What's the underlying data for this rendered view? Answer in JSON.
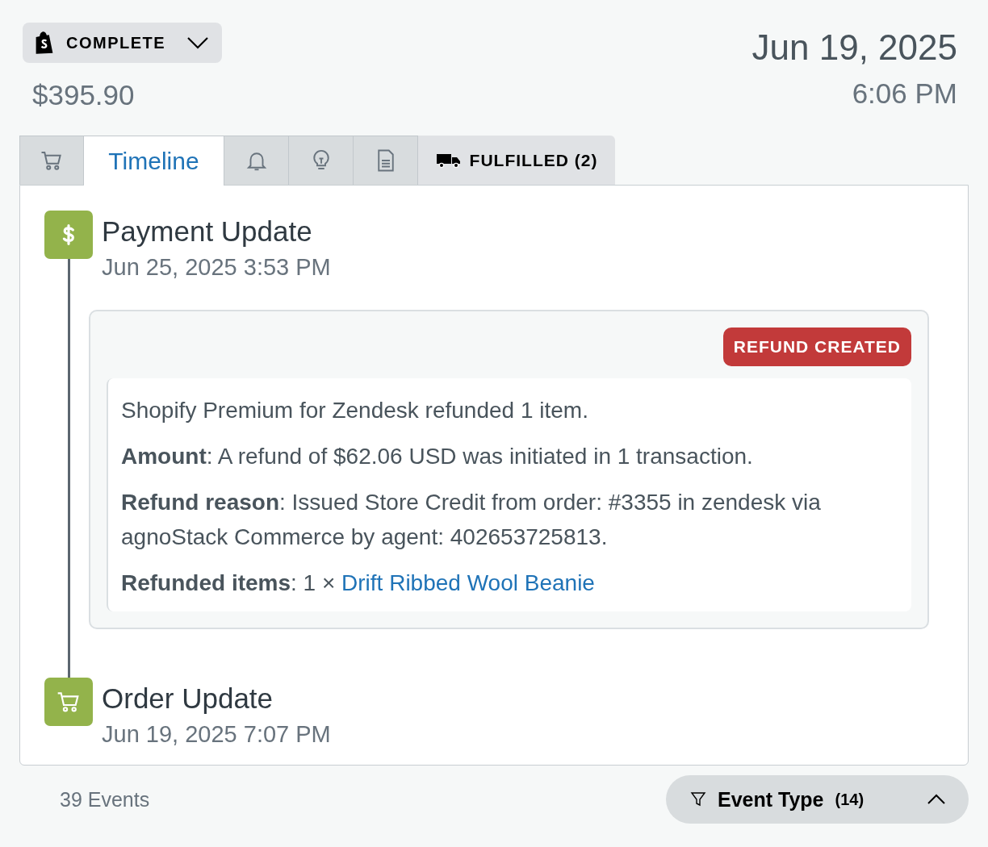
{
  "header": {
    "status": "COMPLETE",
    "total": "$395.90",
    "date": "Jun 19, 2025",
    "time": "6:06 PM"
  },
  "tabs": [
    {
      "kind": "cart",
      "selected": false
    },
    {
      "kind": "text",
      "label": "Timeline",
      "selected": true
    },
    {
      "kind": "bell",
      "selected": false
    },
    {
      "kind": "bulb",
      "selected": false
    },
    {
      "kind": "document",
      "selected": false
    },
    {
      "kind": "status",
      "label": "FULFILLED (2)",
      "selected": false
    }
  ],
  "events": [
    {
      "kind": "payment",
      "title": "Payment Update",
      "time": "Jun 25, 2025 3:53 PM",
      "detail": {
        "badge": "REFUND CREATED",
        "lines": [
          {
            "text": "Shopify Premium for Zendesk refunded 1 item."
          },
          {
            "text": "**Amount**: A refund of $62.06 USD was initiated in 1 transaction."
          },
          {
            "text": "**Refund reason**: Issued Store Credit from order: #3355 in zendesk via agnoStack Commerce by agent: 402653725813."
          },
          {
            "text": "**Refunded items**: 1 × ",
            "link": "Drift Ribbed Wool Beanie"
          }
        ]
      }
    },
    {
      "kind": "order",
      "title": "Order Update",
      "time": "Jun 19, 2025 7:07 PM"
    }
  ],
  "footer": {
    "count": "39",
    "count_label": "Events",
    "filter": {
      "label": "Event Type",
      "count": "(14)",
      "expanded": true
    }
  }
}
